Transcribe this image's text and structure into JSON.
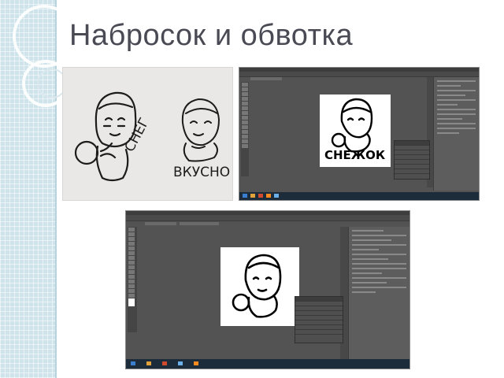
{
  "slide": {
    "title": "Набросок и обвотка"
  },
  "colors": {
    "band": "#cfe3ea",
    "title": "#4a4a55",
    "ui_dark": "#535353",
    "taskbar": "#1d2c3a"
  },
  "sketch": {
    "caption_left": "СНЕГ",
    "caption_right": "ВКУСНО"
  },
  "shot1": {
    "art_caption": "СНЕЖОК"
  }
}
